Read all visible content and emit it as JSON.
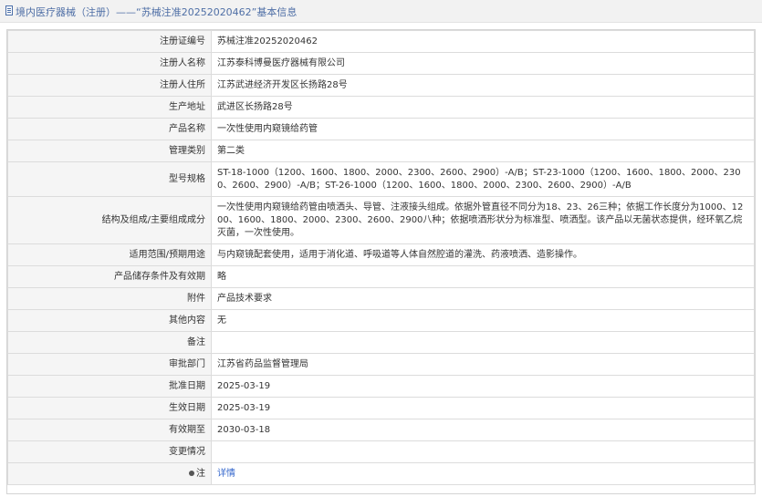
{
  "header": {
    "title": "境内医疗器械（注册）——“苏械注准20252020462”基本信息"
  },
  "rows": [
    {
      "label": "注册证编号",
      "value": "苏械注准20252020462"
    },
    {
      "label": "注册人名称",
      "value": "江苏泰科博曼医疗器械有限公司"
    },
    {
      "label": "注册人住所",
      "value": "江苏武进经济开发区长扬路28号"
    },
    {
      "label": "生产地址",
      "value": "武进区长扬路28号"
    },
    {
      "label": "产品名称",
      "value": "一次性使用内窥镜给药管"
    },
    {
      "label": "管理类别",
      "value": "第二类"
    },
    {
      "label": "型号规格",
      "value": "ST-18-1000（1200、1600、1800、2000、2300、2600、2900）-A/B；ST-23-1000（1200、1600、1800、2000、2300、2600、2900）-A/B；ST-26-1000（1200、1600、1800、2000、2300、2600、2900）-A/B"
    },
    {
      "label": "结构及组成/主要组成成分",
      "value": "一次性使用内窥镜给药管由喷洒头、导管、注液接头组成。依据外管直径不同分为18、23、26三种；依据工作长度分为1000、1200、1600、1800、2000、2300、2600、2900八种；依据喷洒形状分为标准型、喷洒型。该产品以无菌状态提供，经环氧乙烷灭菌，一次性使用。"
    },
    {
      "label": "适用范围/预期用途",
      "value": "与内窥镜配套使用，适用于消化道、呼吸道等人体自然腔道的灌洗、药液喷洒、造影操作。"
    },
    {
      "label": "产品储存条件及有效期",
      "value": "略"
    },
    {
      "label": "附件",
      "value": "产品技术要求"
    },
    {
      "label": "其他内容",
      "value": "无"
    },
    {
      "label": "备注",
      "value": ""
    },
    {
      "label": "审批部门",
      "value": "江苏省药品监督管理局"
    },
    {
      "label": "批准日期",
      "value": "2025-03-19"
    },
    {
      "label": "生效日期",
      "value": "2025-03-19"
    },
    {
      "label": "有效期至",
      "value": "2030-03-18"
    },
    {
      "label": "变更情况",
      "value": ""
    },
    {
      "label": "注",
      "value": "详情"
    }
  ]
}
